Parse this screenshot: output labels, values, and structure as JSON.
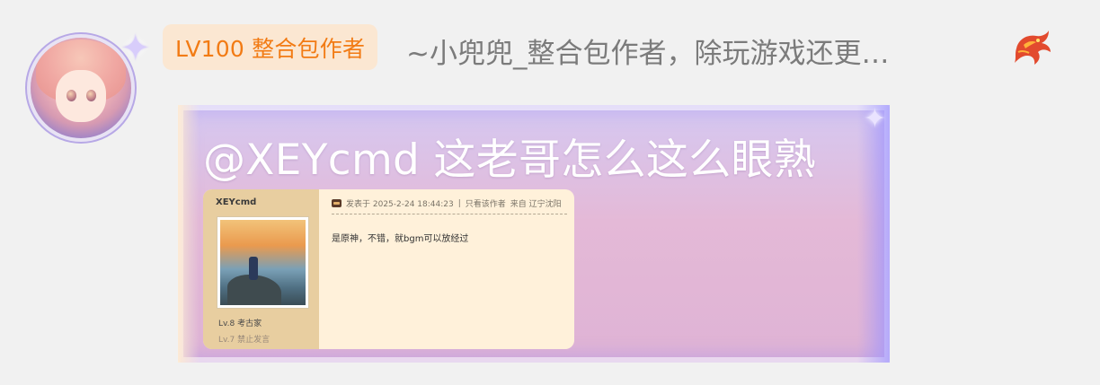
{
  "user": {
    "badge": "LV100 整合包作者",
    "name": "~小兜兜_整合包作者，除玩游戏还更…",
    "avatar_icon": "anime-girl-avatar",
    "decoration_icon": "dragon-icon"
  },
  "post": {
    "text": "@XEYcmd 这老哥怎么这么眼熟"
  },
  "embedded_screenshot": {
    "username": "XEYcmd",
    "level": "Lv.8 考古家",
    "level2": "Lv.7 禁止发言",
    "meta_posted": "发表于 2025-2-24 18:44:23",
    "meta_separator": "|",
    "meta_only_author": "只看该作者",
    "meta_from": "来自 辽宁沈阳",
    "body": "是原神，不错，就bgm可以放经过"
  },
  "colors": {
    "badge_text": "#f27b14",
    "badge_bg": "#fbe7d2",
    "name_text": "#7b7b7b",
    "frame_bg": "#dfb3d5"
  }
}
